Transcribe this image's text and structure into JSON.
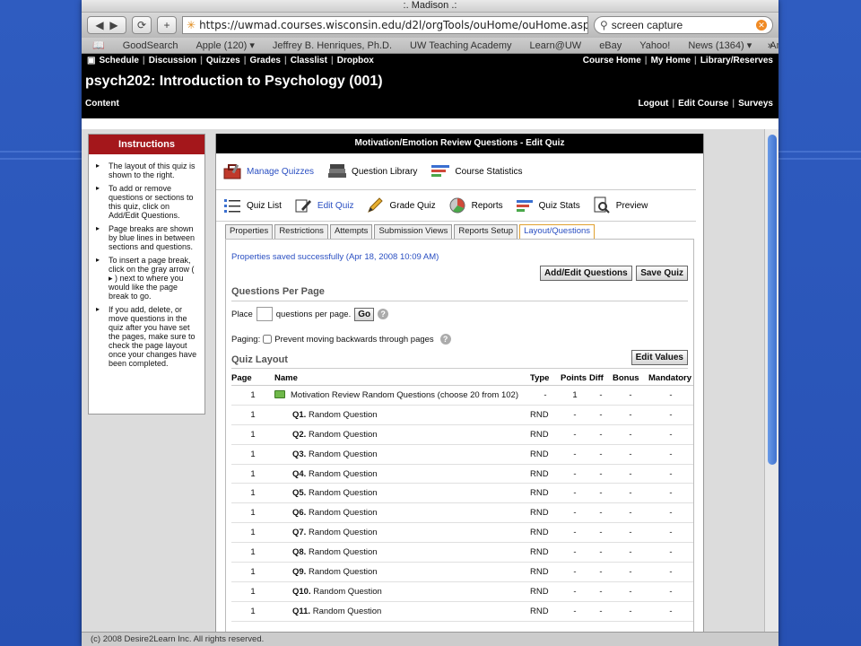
{
  "browser": {
    "window_title": ":. Madison .:",
    "url": "https://uwmad.courses.wisconsin.edu/d2l/orgTools/ouHome/ouHome.asp?ou=",
    "search_value": "screen capture",
    "bookmarks": [
      "GoodSearch",
      "Apple (120) ▾",
      "Jeffrey B. Henriques, Ph.D.",
      "UW Teaching Academy",
      "Learn@UW",
      "eBay",
      "Yahoo!",
      "News (1364) ▾",
      "Amazon"
    ]
  },
  "header": {
    "nav_left": [
      "Schedule",
      "Discussion",
      "Quizzes",
      "Grades",
      "Classlist",
      "Dropbox"
    ],
    "nav_right": [
      "Course Home",
      "My Home",
      "Library/Reserves"
    ],
    "course_title": "psych202: Introduction to Psychology (001)",
    "content_link": "Content",
    "nav_bottom_right": [
      "Logout",
      "Edit Course",
      "Surveys"
    ]
  },
  "instructions": {
    "title": "Instructions",
    "items": [
      "The layout of this quiz is shown to the right.",
      "To add or remove questions or sections to this quiz, click on Add/Edit Questions.",
      "Page breaks are shown by blue lines in between sections and questions.",
      "To insert a page break, click on the gray arrow ( ▸ ) next to where you would like the page break to go.",
      "If you add, delete, or move questions in the quiz after you have set the pages, make sure to check the page layout once your changes have been completed."
    ]
  },
  "panel": {
    "title": "Motivation/Emotion Review Questions - Edit Quiz",
    "top_tools": [
      "Manage Quizzes",
      "Question Library",
      "Course Statistics"
    ],
    "sub_tools": [
      "Quiz List",
      "Edit Quiz",
      "Grade Quiz",
      "Reports",
      "Quiz Stats",
      "Preview"
    ],
    "tabs": [
      "Properties",
      "Restrictions",
      "Attempts",
      "Submission Views",
      "Reports Setup",
      "Layout/Questions"
    ],
    "saved_message": "Properties saved successfully (Apr 18, 2008 10:09 AM)",
    "add_edit_button": "Add/Edit Questions",
    "save_button": "Save Quiz",
    "qpp_title": "Questions Per Page",
    "place_label": "Place",
    "place_value": "",
    "qpp_suffix": "questions per page.",
    "go_button": "Go",
    "paging_label": "Paging:",
    "paging_option": "Prevent moving backwards through pages",
    "layout_title": "Quiz Layout",
    "edit_values_button": "Edit Values",
    "columns": [
      "Page",
      "Name",
      "Type",
      "Points",
      "Diff",
      "Bonus",
      "Mandatory"
    ],
    "section_row": {
      "page": "1",
      "name": "Motivation Review Random Questions (choose 20 from 102)",
      "type": "-",
      "points": "1",
      "diff": "-",
      "bonus": "-",
      "mandatory": "-"
    },
    "rows": [
      {
        "page": "1",
        "qnum": "Q1.",
        "name": "Random Question",
        "type": "RND",
        "points": "-",
        "diff": "-",
        "bonus": "-",
        "mandatory": "-"
      },
      {
        "page": "1",
        "qnum": "Q2.",
        "name": "Random Question",
        "type": "RND",
        "points": "-",
        "diff": "-",
        "bonus": "-",
        "mandatory": "-"
      },
      {
        "page": "1",
        "qnum": "Q3.",
        "name": "Random Question",
        "type": "RND",
        "points": "-",
        "diff": "-",
        "bonus": "-",
        "mandatory": "-"
      },
      {
        "page": "1",
        "qnum": "Q4.",
        "name": "Random Question",
        "type": "RND",
        "points": "-",
        "diff": "-",
        "bonus": "-",
        "mandatory": "-"
      },
      {
        "page": "1",
        "qnum": "Q5.",
        "name": "Random Question",
        "type": "RND",
        "points": "-",
        "diff": "-",
        "bonus": "-",
        "mandatory": "-"
      },
      {
        "page": "1",
        "qnum": "Q6.",
        "name": "Random Question",
        "type": "RND",
        "points": "-",
        "diff": "-",
        "bonus": "-",
        "mandatory": "-"
      },
      {
        "page": "1",
        "qnum": "Q7.",
        "name": "Random Question",
        "type": "RND",
        "points": "-",
        "diff": "-",
        "bonus": "-",
        "mandatory": "-"
      },
      {
        "page": "1",
        "qnum": "Q8.",
        "name": "Random Question",
        "type": "RND",
        "points": "-",
        "diff": "-",
        "bonus": "-",
        "mandatory": "-"
      },
      {
        "page": "1",
        "qnum": "Q9.",
        "name": "Random Question",
        "type": "RND",
        "points": "-",
        "diff": "-",
        "bonus": "-",
        "mandatory": "-"
      },
      {
        "page": "1",
        "qnum": "Q10.",
        "name": "Random Question",
        "type": "RND",
        "points": "-",
        "diff": "-",
        "bonus": "-",
        "mandatory": "-"
      },
      {
        "page": "1",
        "qnum": "Q11.",
        "name": "Random Question",
        "type": "RND",
        "points": "-",
        "diff": "-",
        "bonus": "-",
        "mandatory": "-"
      }
    ]
  },
  "footer": {
    "copyright": "(c) 2008 Desire2Learn Inc. All rights reserved."
  },
  "colors": {
    "slide_bg": "#2c55b5",
    "instructions_header": "#a4171b",
    "link_blue": "#2a4fc2",
    "d2l_header": "#000000"
  }
}
